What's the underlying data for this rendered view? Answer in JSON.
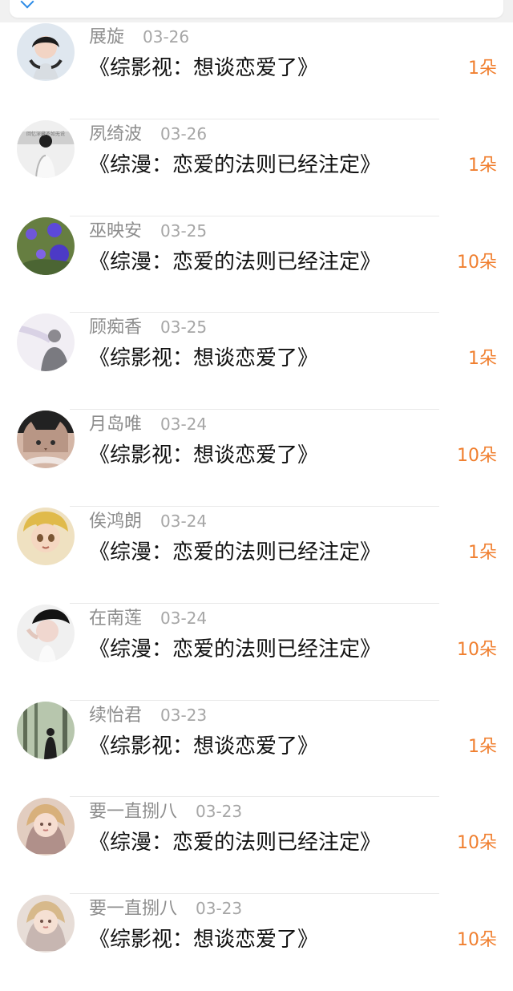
{
  "rows": [
    {
      "name": "展旋",
      "date": "03-26",
      "title": "《综影视：想谈恋爱了》",
      "amount": "1朵",
      "avatar_icon": "avatar-portrait-icon"
    },
    {
      "name": "夙绮波",
      "date": "03-26",
      "title": "《综漫：恋爱的法则已经注定》",
      "amount": "1朵",
      "avatar_icon": "avatar-person-white-shirt-icon"
    },
    {
      "name": "巫映安",
      "date": "03-25",
      "title": "《综漫：恋爱的法则已经注定》",
      "amount": "10朵",
      "avatar_icon": "avatar-flowers-icon"
    },
    {
      "name": "顾痴香",
      "date": "03-25",
      "title": "《综影视：想谈恋爱了》",
      "amount": "1朵",
      "avatar_icon": "avatar-silhouette-icon"
    },
    {
      "name": "月岛唯",
      "date": "03-24",
      "title": "《综影视：想谈恋爱了》",
      "amount": "10朵",
      "avatar_icon": "avatar-cat-icon"
    },
    {
      "name": "俟鸿朗",
      "date": "03-24",
      "title": "《综漫：恋爱的法则已经注定》",
      "amount": "1朵",
      "avatar_icon": "avatar-anime-icon"
    },
    {
      "name": "在南莲",
      "date": "03-24",
      "title": "《综漫：恋爱的法则已经注定》",
      "amount": "10朵",
      "avatar_icon": "avatar-portrait-icon"
    },
    {
      "name": "续怡君",
      "date": "03-23",
      "title": "《综影视：想谈恋爱了》",
      "amount": "1朵",
      "avatar_icon": "avatar-forest-icon"
    },
    {
      "name": "要一直捌八",
      "date": "03-23",
      "title": "《综漫：恋爱的法则已经注定》",
      "amount": "10朵",
      "avatar_icon": "avatar-illustration-icon"
    },
    {
      "name": "要一直捌八",
      "date": "03-23",
      "title": "《综影视：想谈恋爱了》",
      "amount": "10朵",
      "avatar_icon": "avatar-illustration-icon"
    }
  ],
  "colors": {
    "amount": "#f07f2f",
    "name": "#8d8d8d",
    "date": "#a6a6a6",
    "title": "#111111",
    "separator": "#e9e9e9"
  }
}
